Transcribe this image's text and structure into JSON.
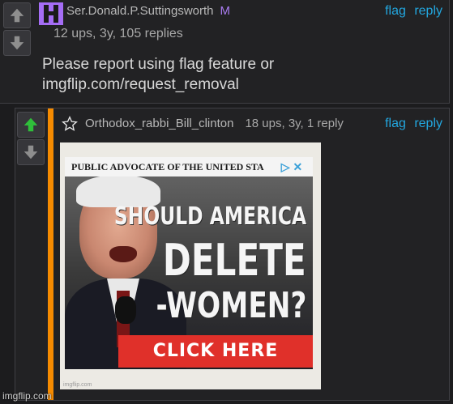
{
  "comment1": {
    "username": "Ser.Donald.P.Suttingsworth",
    "mod_badge": "M",
    "flag_label": "flag",
    "reply_label": "reply",
    "meta": "12 ups, 3y, 105 replies",
    "text": "Please report using flag feature or imgflip.com/request_removal"
  },
  "comment2": {
    "username": "Orthodox_rabbi_Bill_clinton",
    "stats": "18 ups, 3y, 1 reply",
    "flag_label": "flag",
    "reply_label": "reply",
    "accent_color": "#f68b00",
    "upvoted": true,
    "meme": {
      "header": "PUBLIC ADVOCATE OF THE UNITED STA",
      "line1": "SHOULD AMERICA",
      "line2": "DELETE",
      "line3": "-WOMEN?",
      "button": "CLICK HERE",
      "ad_marker": "▷ ✕",
      "credit": "imgflip.com"
    }
  },
  "watermark": "imgflip.com",
  "icons": {
    "upvote": "arrow-up-icon",
    "downvote": "arrow-down-icon",
    "avatar": "h-avatar-icon",
    "star": "star-outline-icon"
  }
}
